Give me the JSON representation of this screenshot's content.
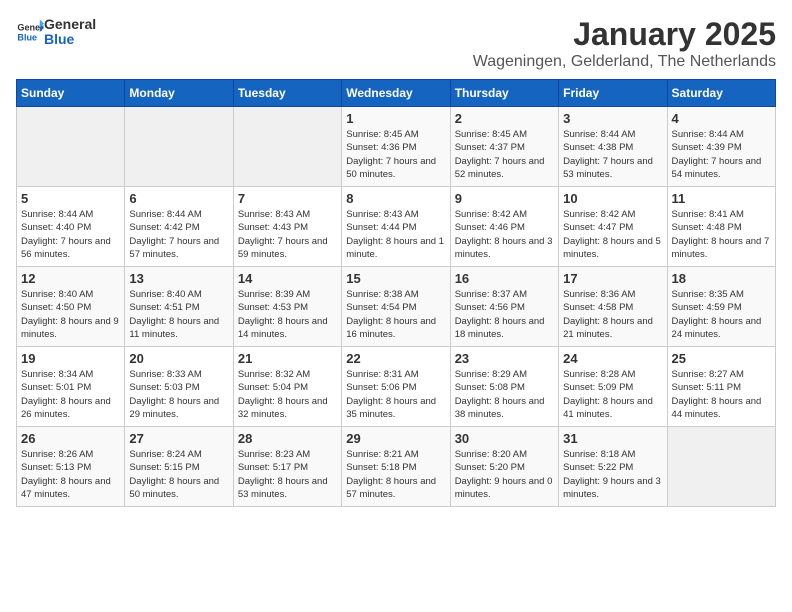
{
  "header": {
    "logo_general": "General",
    "logo_blue": "Blue",
    "title": "January 2025",
    "subtitle": "Wageningen, Gelderland, The Netherlands"
  },
  "columns": [
    "Sunday",
    "Monday",
    "Tuesday",
    "Wednesday",
    "Thursday",
    "Friday",
    "Saturday"
  ],
  "weeks": [
    [
      {
        "day": "",
        "sunrise": "",
        "sunset": "",
        "daylight": ""
      },
      {
        "day": "",
        "sunrise": "",
        "sunset": "",
        "daylight": ""
      },
      {
        "day": "",
        "sunrise": "",
        "sunset": "",
        "daylight": ""
      },
      {
        "day": "1",
        "sunrise": "Sunrise: 8:45 AM",
        "sunset": "Sunset: 4:36 PM",
        "daylight": "Daylight: 7 hours and 50 minutes."
      },
      {
        "day": "2",
        "sunrise": "Sunrise: 8:45 AM",
        "sunset": "Sunset: 4:37 PM",
        "daylight": "Daylight: 7 hours and 52 minutes."
      },
      {
        "day": "3",
        "sunrise": "Sunrise: 8:44 AM",
        "sunset": "Sunset: 4:38 PM",
        "daylight": "Daylight: 7 hours and 53 minutes."
      },
      {
        "day": "4",
        "sunrise": "Sunrise: 8:44 AM",
        "sunset": "Sunset: 4:39 PM",
        "daylight": "Daylight: 7 hours and 54 minutes."
      }
    ],
    [
      {
        "day": "5",
        "sunrise": "Sunrise: 8:44 AM",
        "sunset": "Sunset: 4:40 PM",
        "daylight": "Daylight: 7 hours and 56 minutes."
      },
      {
        "day": "6",
        "sunrise": "Sunrise: 8:44 AM",
        "sunset": "Sunset: 4:42 PM",
        "daylight": "Daylight: 7 hours and 57 minutes."
      },
      {
        "day": "7",
        "sunrise": "Sunrise: 8:43 AM",
        "sunset": "Sunset: 4:43 PM",
        "daylight": "Daylight: 7 hours and 59 minutes."
      },
      {
        "day": "8",
        "sunrise": "Sunrise: 8:43 AM",
        "sunset": "Sunset: 4:44 PM",
        "daylight": "Daylight: 8 hours and 1 minute."
      },
      {
        "day": "9",
        "sunrise": "Sunrise: 8:42 AM",
        "sunset": "Sunset: 4:46 PM",
        "daylight": "Daylight: 8 hours and 3 minutes."
      },
      {
        "day": "10",
        "sunrise": "Sunrise: 8:42 AM",
        "sunset": "Sunset: 4:47 PM",
        "daylight": "Daylight: 8 hours and 5 minutes."
      },
      {
        "day": "11",
        "sunrise": "Sunrise: 8:41 AM",
        "sunset": "Sunset: 4:48 PM",
        "daylight": "Daylight: 8 hours and 7 minutes."
      }
    ],
    [
      {
        "day": "12",
        "sunrise": "Sunrise: 8:40 AM",
        "sunset": "Sunset: 4:50 PM",
        "daylight": "Daylight: 8 hours and 9 minutes."
      },
      {
        "day": "13",
        "sunrise": "Sunrise: 8:40 AM",
        "sunset": "Sunset: 4:51 PM",
        "daylight": "Daylight: 8 hours and 11 minutes."
      },
      {
        "day": "14",
        "sunrise": "Sunrise: 8:39 AM",
        "sunset": "Sunset: 4:53 PM",
        "daylight": "Daylight: 8 hours and 14 minutes."
      },
      {
        "day": "15",
        "sunrise": "Sunrise: 8:38 AM",
        "sunset": "Sunset: 4:54 PM",
        "daylight": "Daylight: 8 hours and 16 minutes."
      },
      {
        "day": "16",
        "sunrise": "Sunrise: 8:37 AM",
        "sunset": "Sunset: 4:56 PM",
        "daylight": "Daylight: 8 hours and 18 minutes."
      },
      {
        "day": "17",
        "sunrise": "Sunrise: 8:36 AM",
        "sunset": "Sunset: 4:58 PM",
        "daylight": "Daylight: 8 hours and 21 minutes."
      },
      {
        "day": "18",
        "sunrise": "Sunrise: 8:35 AM",
        "sunset": "Sunset: 4:59 PM",
        "daylight": "Daylight: 8 hours and 24 minutes."
      }
    ],
    [
      {
        "day": "19",
        "sunrise": "Sunrise: 8:34 AM",
        "sunset": "Sunset: 5:01 PM",
        "daylight": "Daylight: 8 hours and 26 minutes."
      },
      {
        "day": "20",
        "sunrise": "Sunrise: 8:33 AM",
        "sunset": "Sunset: 5:03 PM",
        "daylight": "Daylight: 8 hours and 29 minutes."
      },
      {
        "day": "21",
        "sunrise": "Sunrise: 8:32 AM",
        "sunset": "Sunset: 5:04 PM",
        "daylight": "Daylight: 8 hours and 32 minutes."
      },
      {
        "day": "22",
        "sunrise": "Sunrise: 8:31 AM",
        "sunset": "Sunset: 5:06 PM",
        "daylight": "Daylight: 8 hours and 35 minutes."
      },
      {
        "day": "23",
        "sunrise": "Sunrise: 8:29 AM",
        "sunset": "Sunset: 5:08 PM",
        "daylight": "Daylight: 8 hours and 38 minutes."
      },
      {
        "day": "24",
        "sunrise": "Sunrise: 8:28 AM",
        "sunset": "Sunset: 5:09 PM",
        "daylight": "Daylight: 8 hours and 41 minutes."
      },
      {
        "day": "25",
        "sunrise": "Sunrise: 8:27 AM",
        "sunset": "Sunset: 5:11 PM",
        "daylight": "Daylight: 8 hours and 44 minutes."
      }
    ],
    [
      {
        "day": "26",
        "sunrise": "Sunrise: 8:26 AM",
        "sunset": "Sunset: 5:13 PM",
        "daylight": "Daylight: 8 hours and 47 minutes."
      },
      {
        "day": "27",
        "sunrise": "Sunrise: 8:24 AM",
        "sunset": "Sunset: 5:15 PM",
        "daylight": "Daylight: 8 hours and 50 minutes."
      },
      {
        "day": "28",
        "sunrise": "Sunrise: 8:23 AM",
        "sunset": "Sunset: 5:17 PM",
        "daylight": "Daylight: 8 hours and 53 minutes."
      },
      {
        "day": "29",
        "sunrise": "Sunrise: 8:21 AM",
        "sunset": "Sunset: 5:18 PM",
        "daylight": "Daylight: 8 hours and 57 minutes."
      },
      {
        "day": "30",
        "sunrise": "Sunrise: 8:20 AM",
        "sunset": "Sunset: 5:20 PM",
        "daylight": "Daylight: 9 hours and 0 minutes."
      },
      {
        "day": "31",
        "sunrise": "Sunrise: 8:18 AM",
        "sunset": "Sunset: 5:22 PM",
        "daylight": "Daylight: 9 hours and 3 minutes."
      },
      {
        "day": "",
        "sunrise": "",
        "sunset": "",
        "daylight": ""
      }
    ]
  ]
}
